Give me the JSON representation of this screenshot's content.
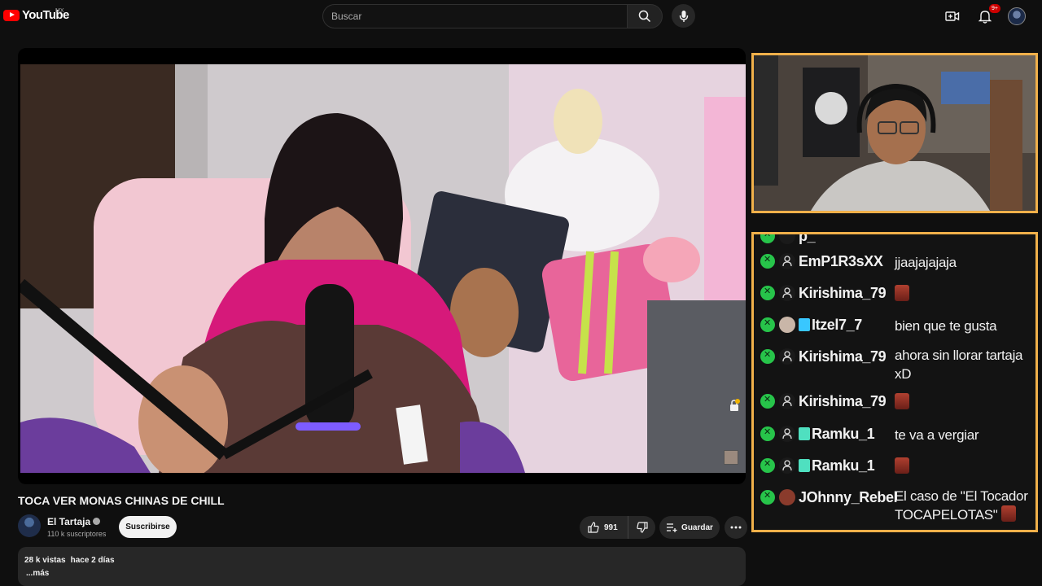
{
  "header": {
    "logo_text": "YouTube",
    "logo_region": "MX",
    "search_placeholder": "Buscar",
    "notification_count": "9+"
  },
  "video": {
    "title": "TOCA VER MONAS CHINAS DE CHILL",
    "channel_name": "El Tartaja",
    "subscribers": "110 k suscriptores",
    "subscribe_label": "Suscribirse",
    "likes": "991",
    "save_label": "Guardar",
    "views": "28 k vistas",
    "posted": "hace 2 días",
    "more_label": "...más"
  },
  "chat": {
    "partial_user": "p_",
    "messages": [
      {
        "user": "EmP1R3sXX",
        "text": "jjaajajajaja",
        "emote": false,
        "badge": "none"
      },
      {
        "user": "Kirishima_79",
        "text": "",
        "emote": true,
        "badge": "none"
      },
      {
        "user": "Itzel7_7",
        "text": "bien que te gusta",
        "emote": false,
        "badge": "sub"
      },
      {
        "user": "Kirishima_79",
        "text": "ahora sin llorar tartaja",
        "text2": "xD",
        "emote": false,
        "badge": "none"
      },
      {
        "user": "Kirishima_79",
        "text": "",
        "emote": true,
        "badge": "none"
      },
      {
        "user": "Ramku_1",
        "text": "te va a vergiar",
        "emote": false,
        "badge": "gift"
      },
      {
        "user": "Ramku_1",
        "text": "",
        "emote": true,
        "badge": "gift"
      },
      {
        "user": "JOhnny_Rebel",
        "text": "El caso de \"El Tocador",
        "text2": "TOCAPELOTAS\"",
        "emote": false,
        "badge": "none"
      }
    ]
  },
  "colors": {
    "accent_orange": "#f0b04a",
    "mod_green": "#27c44a",
    "youtube_red": "#ff0000"
  }
}
